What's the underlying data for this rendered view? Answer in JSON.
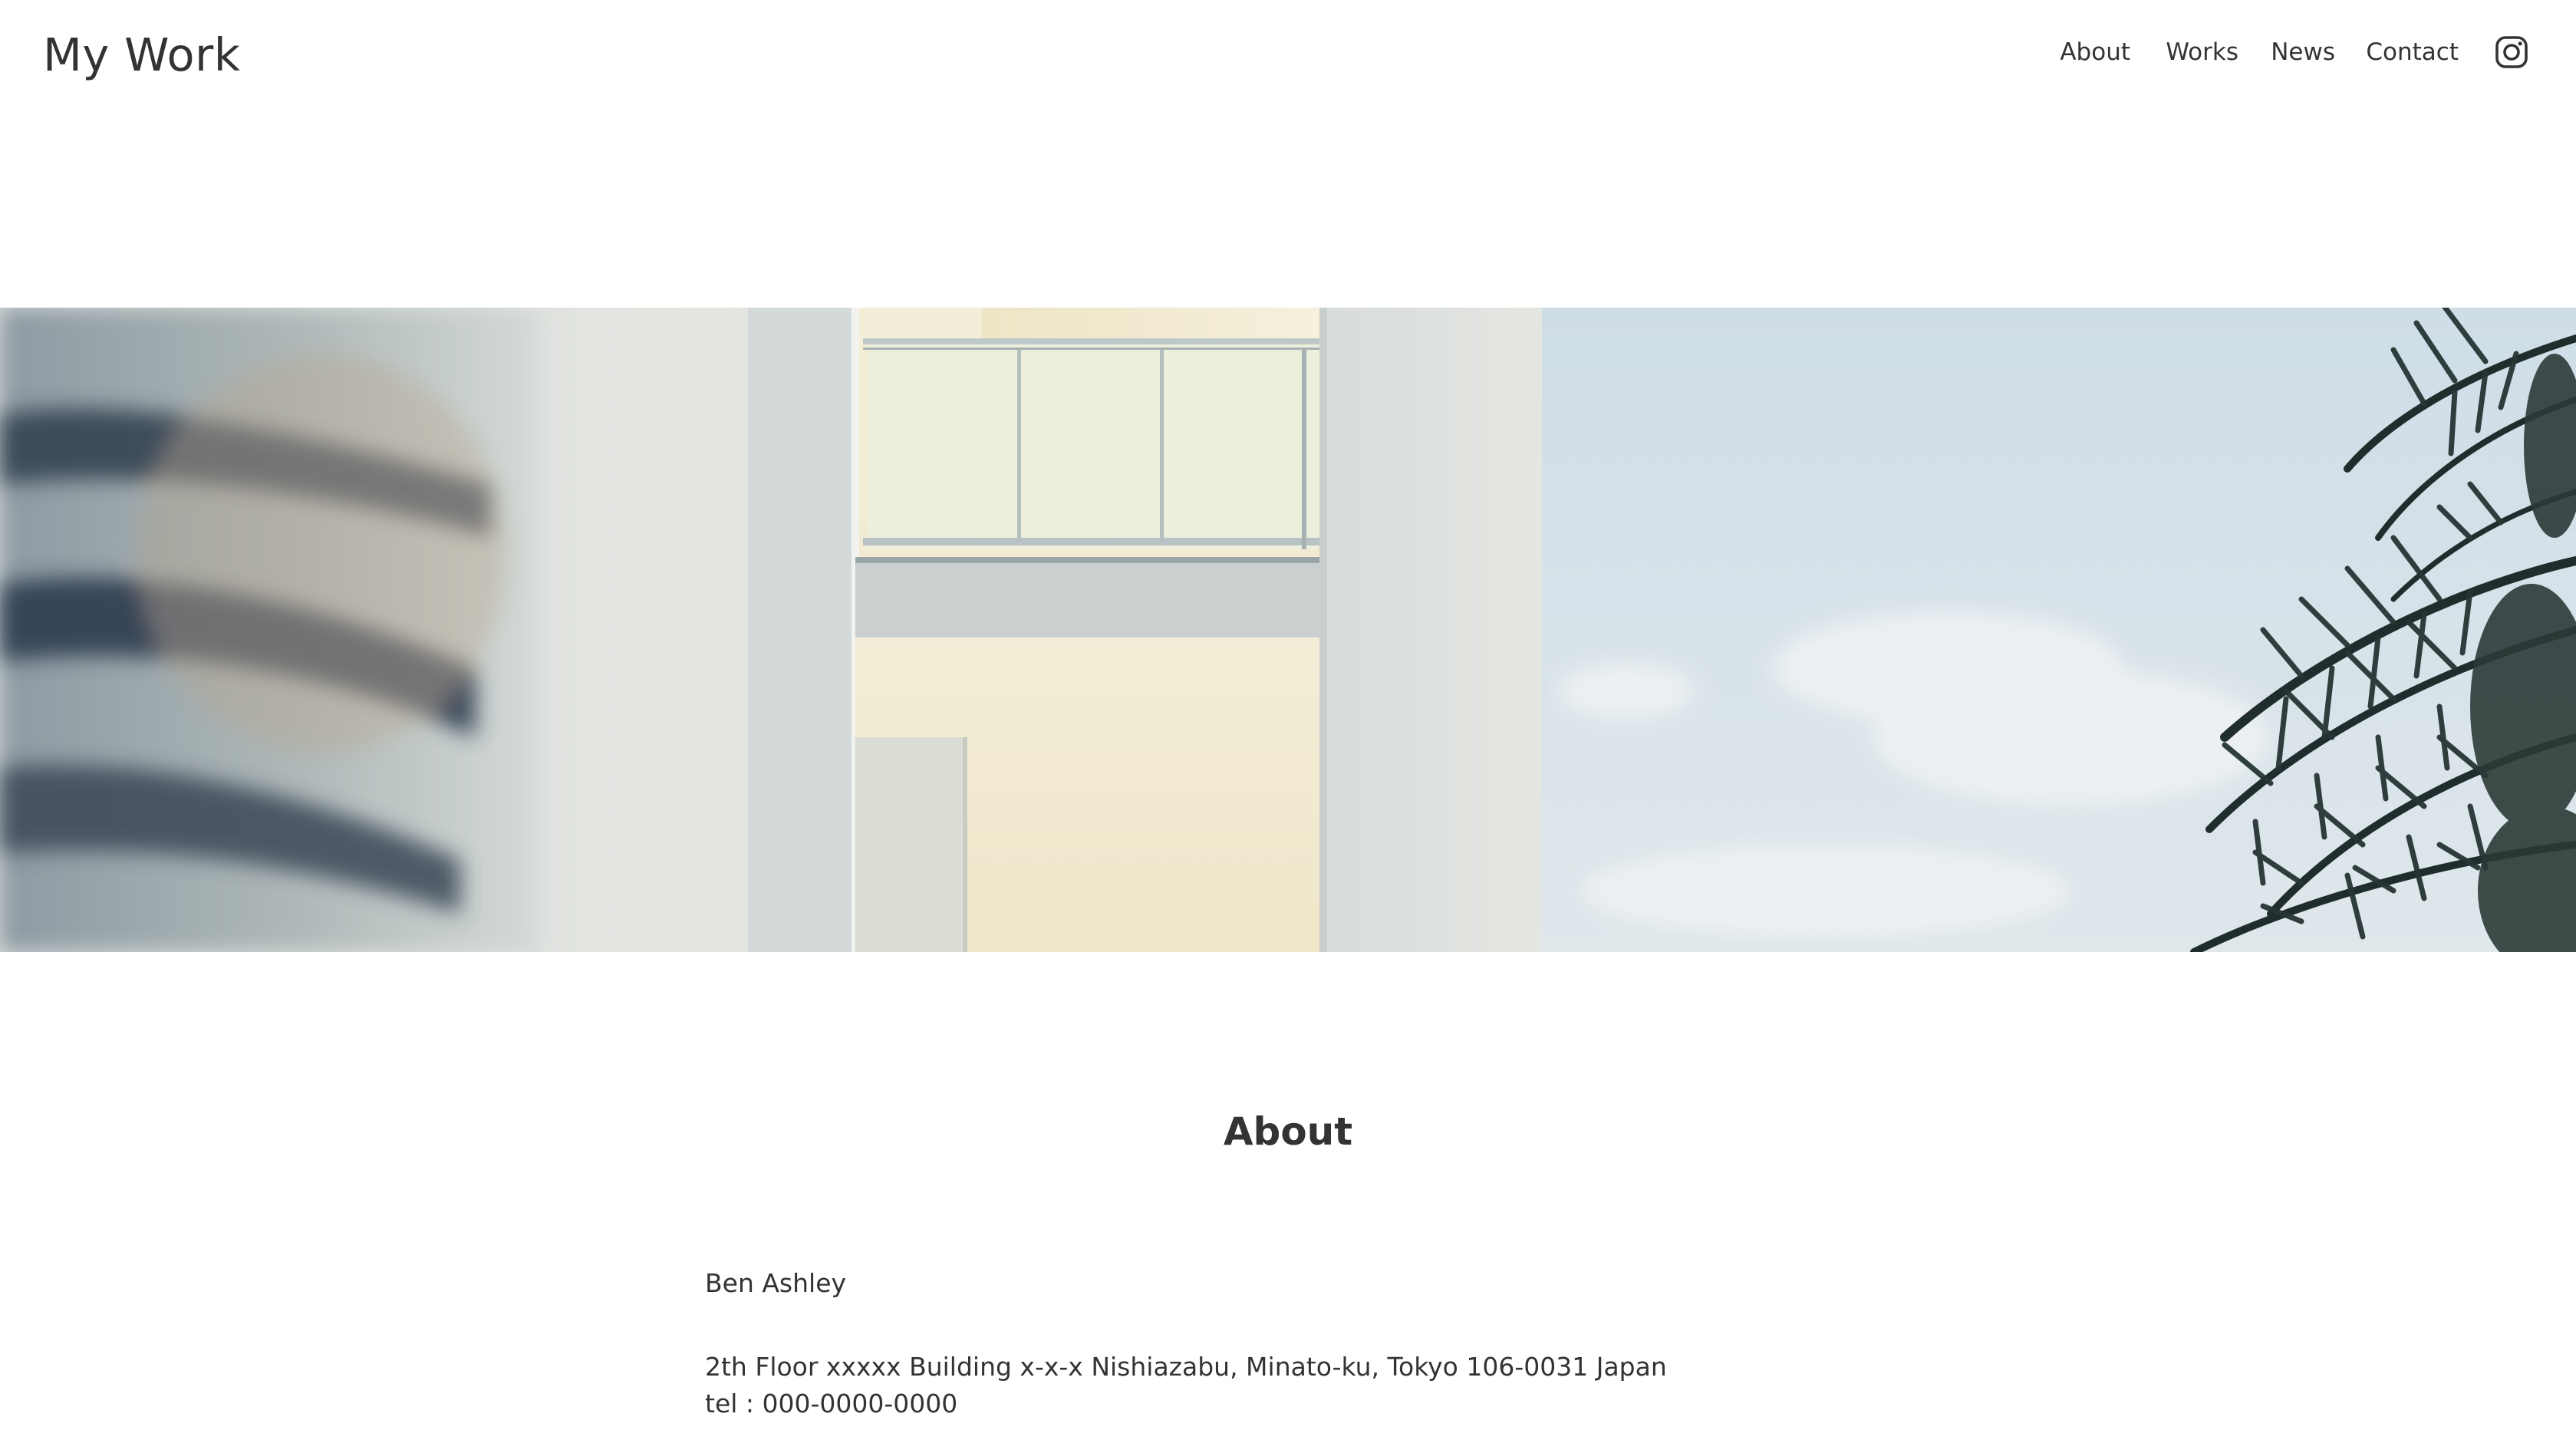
{
  "header": {
    "logo_text": "My Work",
    "nav": [
      {
        "label": "About"
      },
      {
        "label": "Works"
      },
      {
        "label": "News"
      },
      {
        "label": "Contact"
      }
    ],
    "social_icon": "instagram-icon"
  },
  "hero": {
    "image_subject": "white building with balcony, sky and palm leaves"
  },
  "about": {
    "title": "About",
    "name": "Ben Ashley",
    "address": "2th Floor xxxxx Building x-x-x Nishiazabu, Minato-ku, Tokyo 106-0031 Japan",
    "tel": "tel : 000-0000-0000"
  },
  "colors": {
    "text": "#333333",
    "background": "#ffffff",
    "sky": "#d4e2ea",
    "wall": "#dfe3e1",
    "palm": "#23302f"
  }
}
